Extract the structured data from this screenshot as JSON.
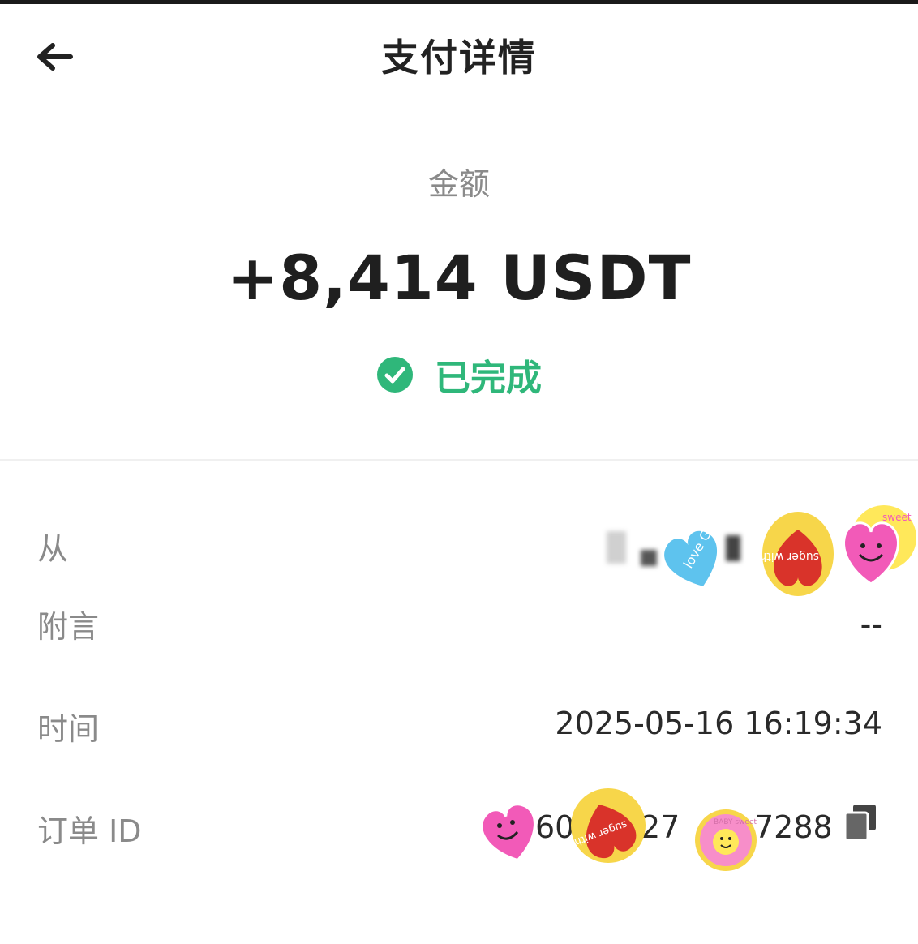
{
  "header": {
    "title": "支付详情",
    "back_icon": "arrow-left-icon"
  },
  "amount": {
    "label": "金额",
    "value": "+8,414 USDT"
  },
  "status": {
    "text": "已完成",
    "icon": "check-circle-icon",
    "color": "#2fb77a"
  },
  "details": {
    "from_label": "从",
    "note_label": "附言",
    "note_value": "--",
    "time_label": "时间",
    "time_value": "2025-05-16 16:19:34",
    "order_label": "订单 ID",
    "order_value_parts": [
      "60",
      "27",
      "7288"
    ],
    "copy_icon": "copy-icon"
  },
  "stickers": [
    {
      "text": "love GOOD"
    },
    {
      "text": "suger with love"
    },
    {
      "text": "sweet"
    },
    {
      "text": "suger with love"
    },
    {
      "text": "BABY sweet"
    }
  ]
}
